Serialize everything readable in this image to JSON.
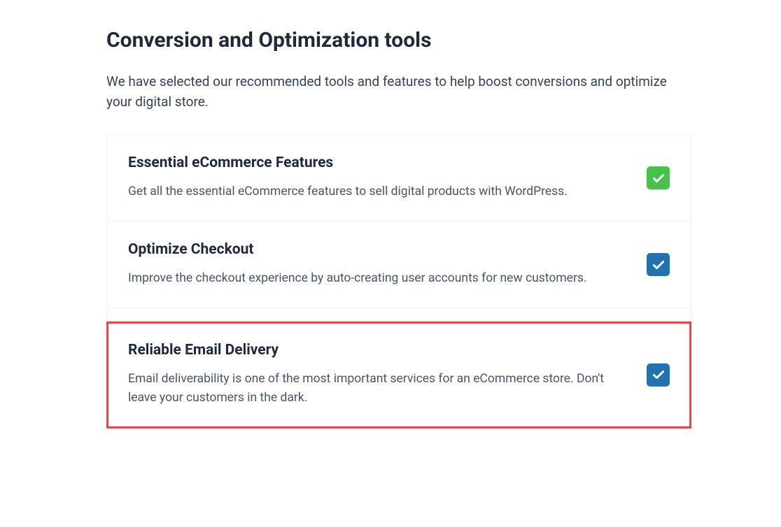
{
  "header": {
    "title": "Conversion and Optimization tools",
    "description": "We have selected our recommended tools and features to help boost conversions and optimize your digital store."
  },
  "features": [
    {
      "title": "Essential eCommerce Features",
      "description": "Get all the essential eCommerce features to sell digital products with WordPress.",
      "checked": true,
      "checkbox_color": "green",
      "highlighted": false
    },
    {
      "title": "Optimize Checkout",
      "description": "Improve the checkout experience by auto-creating user accounts for new customers.",
      "checked": true,
      "checkbox_color": "blue",
      "highlighted": false
    },
    {
      "title": "Reliable Email Delivery",
      "description": "Email deliverability is one of the most important services for an eCommerce store. Don't leave your customers in the dark.",
      "checked": true,
      "checkbox_color": "blue",
      "highlighted": true
    }
  ]
}
